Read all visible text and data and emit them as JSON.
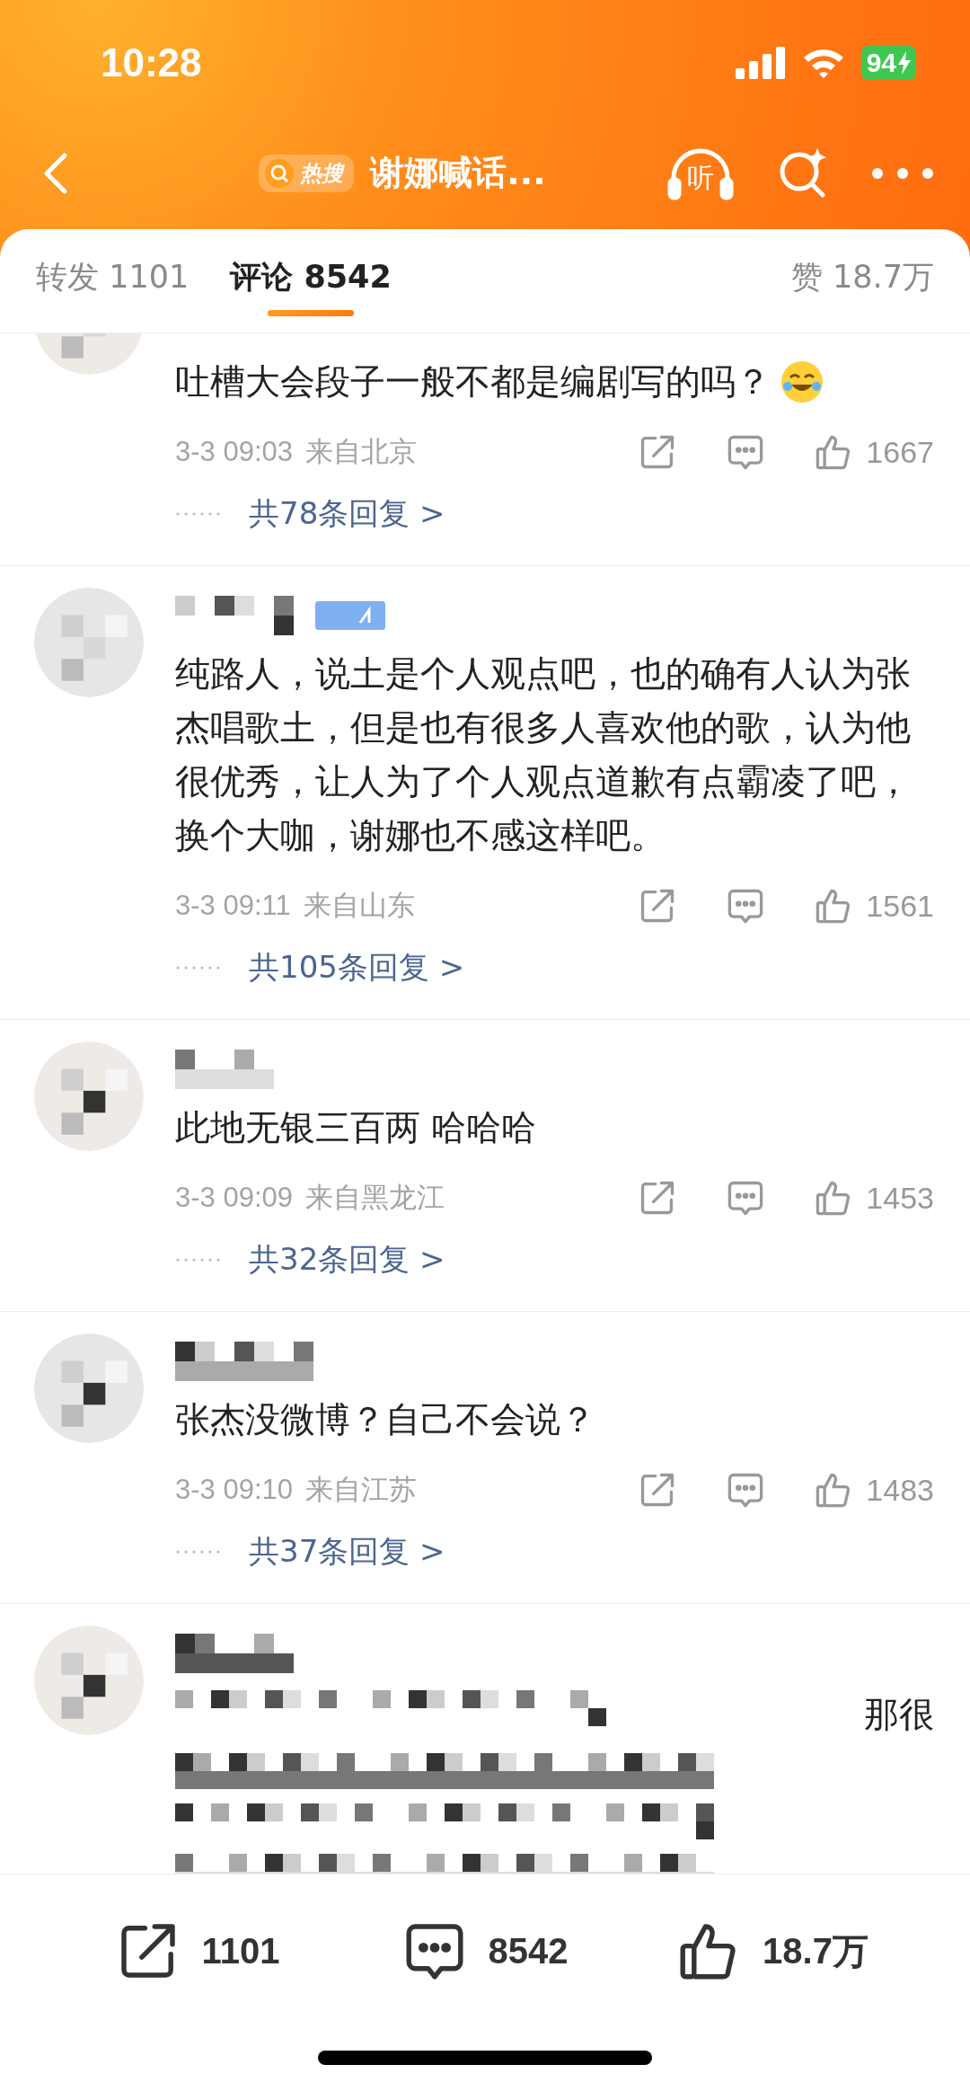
{
  "status_bar": {
    "time": "10:28",
    "battery": "94"
  },
  "header": {
    "badge": "热搜",
    "title": "谢娜喊话...",
    "listen": "听"
  },
  "tabs": [
    {
      "label": "转发 1101",
      "selected": false
    },
    {
      "label": "评论 8542",
      "selected": true
    }
  ],
  "likes_tab": "赞 18.7万",
  "comments": [
    {
      "masked_name": false,
      "badge": false,
      "text": "吐槽大会段子一般不都是编剧写的吗？",
      "emoji": true,
      "masked_text": false,
      "time": "3-3 09:03",
      "location": "来自北京",
      "likes": "1667",
      "replies": "共78条回复 >"
    },
    {
      "masked_name": true,
      "badge": true,
      "text": "纯路人，说土是个人观点吧，也的确有人认为张杰唱歌土，但是也有很多人喜欢他的歌，认为他很优秀，让人为了个人观点道歉有点霸凌了吧，换个大咖，谢娜也不感这样吧。",
      "emoji": false,
      "masked_text": false,
      "time": "3-3 09:11",
      "location": "来自山东",
      "likes": "1561",
      "replies": "共105条回复 >"
    },
    {
      "masked_name": true,
      "badge": false,
      "text": "此地无银三百两 哈哈哈",
      "emoji": false,
      "masked_text": false,
      "time": "3-3 09:09",
      "location": "来自黑龙江",
      "likes": "1453",
      "replies": "共32条回复 >"
    },
    {
      "masked_name": true,
      "badge": false,
      "text": "张杰没微博？自己不会说？",
      "emoji": false,
      "masked_text": false,
      "time": "3-3 09:10",
      "location": "来自江苏",
      "likes": "1483",
      "replies": "共37条回复 >"
    },
    {
      "masked_name": true,
      "badge": false,
      "text": "那很",
      "emoji": false,
      "masked_text": true
    }
  ],
  "bottom_bar": {
    "reposts": "1101",
    "comments": "8542",
    "likes": "18.7万"
  }
}
